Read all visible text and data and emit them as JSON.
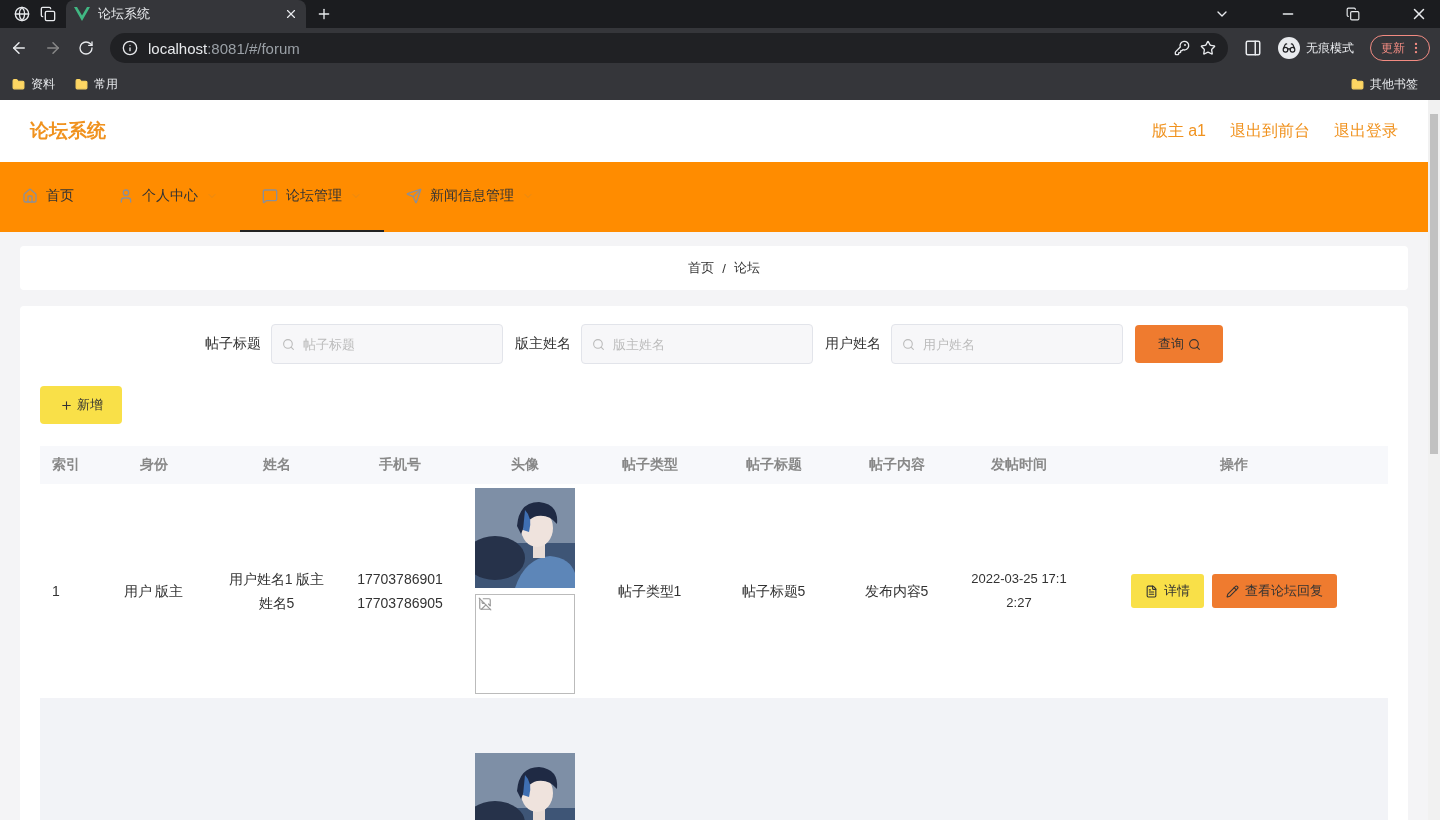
{
  "browser": {
    "tab_title": "论坛系统",
    "url": {
      "host": "localhost",
      "path": ":8081/#/forum"
    },
    "incognito": "无痕模式",
    "update": "更新",
    "bookmarks": [
      "资料",
      "常用"
    ],
    "other_bookmarks": "其他书签"
  },
  "header": {
    "title": "论坛系统",
    "links": [
      "版主 a1",
      "退出到前台",
      "退出登录"
    ]
  },
  "nav": [
    {
      "label": "首页",
      "has_menu": false,
      "selected": false
    },
    {
      "label": "个人中心",
      "has_menu": true,
      "selected": false
    },
    {
      "label": "论坛管理",
      "has_menu": true,
      "selected": true
    },
    {
      "label": "新闻信息管理",
      "has_menu": true,
      "selected": false
    }
  ],
  "breadcrumb": {
    "items": [
      "首页",
      "论坛"
    ],
    "separator": "/"
  },
  "search": {
    "fields": [
      {
        "label": "帖子标题",
        "placeholder": "帖子标题"
      },
      {
        "label": "版主姓名",
        "placeholder": "版主姓名"
      },
      {
        "label": "用户姓名",
        "placeholder": "用户姓名"
      }
    ],
    "button": "查询"
  },
  "add_button": "新增",
  "table": {
    "columns": [
      "索引",
      "身份",
      "姓名",
      "手机号",
      "头像",
      "帖子类型",
      "帖子标题",
      "帖子内容",
      "发帖时间",
      "操作"
    ],
    "rows": [
      {
        "cells": [
          "1",
          "用户 版主",
          "用户姓名1 版主姓名5",
          "17703786901 17703786905"
        ],
        "avatars": [
          {
            "kind": "picture"
          },
          {
            "kind": "broken"
          }
        ],
        "cells_after": [
          "帖子类型1",
          "帖子标题5",
          "发布内容5",
          "2022-03-25 17:12:27"
        ],
        "actions": [
          {
            "label": "详情",
            "kind": "detail"
          },
          {
            "label": "查看论坛回复",
            "kind": "reply"
          }
        ]
      },
      {
        "cells": [],
        "avatars": [
          {
            "kind": "picture"
          }
        ],
        "cells_after": [],
        "actions": []
      }
    ]
  }
}
